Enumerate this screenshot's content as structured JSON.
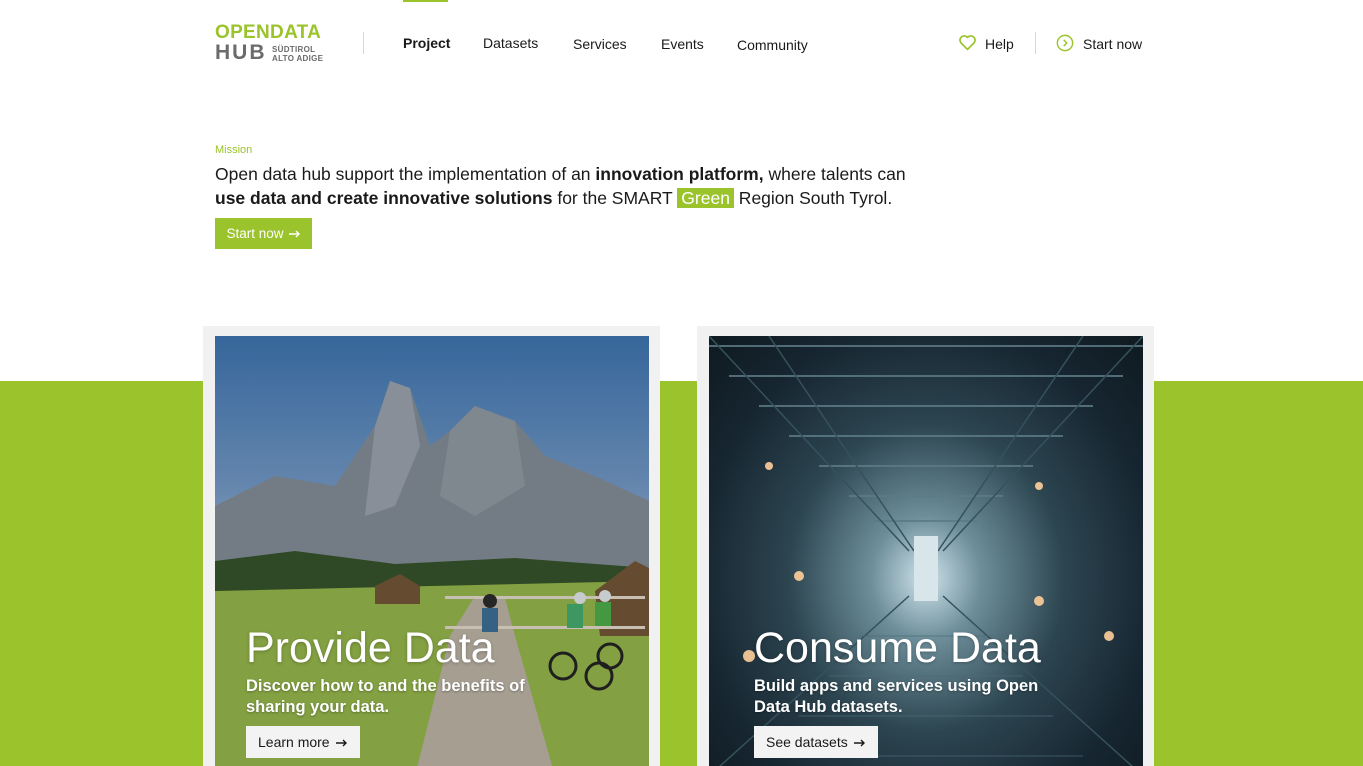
{
  "logo": {
    "line1": "OPENDATA",
    "line2": "HUB",
    "sub1": "SÜDTIROL",
    "sub2": "ALTO ADIGE"
  },
  "nav": {
    "items": [
      {
        "label": "Project",
        "active": true
      },
      {
        "label": "Datasets"
      },
      {
        "label": "Services"
      },
      {
        "label": "Events"
      },
      {
        "label": "Community"
      }
    ],
    "help_label": "Help",
    "start_label": "Start now"
  },
  "mission": {
    "label": "Mission",
    "t1": "Open data hub support the implementation of an ",
    "b1": "innovation platform,",
    "t2": " where talents can ",
    "b2": "use data and create innovative solutions",
    "t3": " for the SMART ",
    "highlight": "Green",
    "t4": " Region South Tyrol.",
    "cta_label": "Start now"
  },
  "cards": [
    {
      "title": "Provide Data",
      "description": "Discover how to and the benefits of sharing your data.",
      "button_label": "Learn more"
    },
    {
      "title": "Consume Data",
      "description": "Build apps and services using Open Data Hub datasets.",
      "button_label": "See datasets"
    }
  ],
  "colors": {
    "accent": "#9bc32b",
    "text": "#1a1a1a",
    "logo_gray": "#6b6b6b"
  },
  "icons": {
    "help": "heart-icon",
    "start": "chevron-right-circle-icon",
    "arrow": "arrow-right-icon"
  }
}
